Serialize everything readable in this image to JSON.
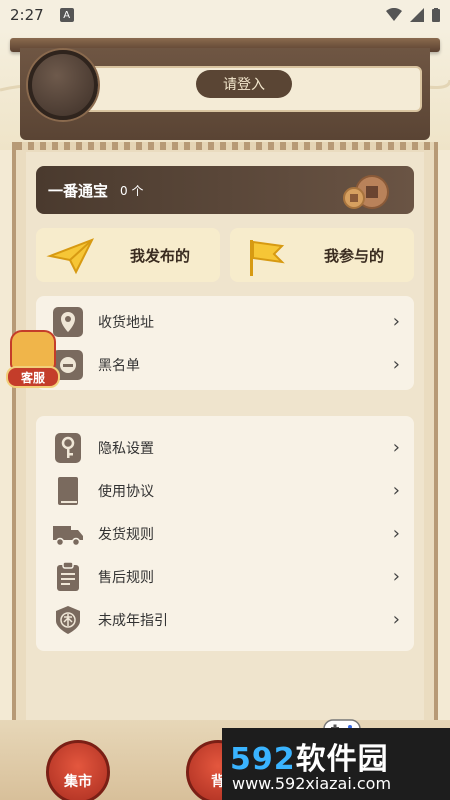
{
  "status_bar": {
    "time": "2:27",
    "badge": "A"
  },
  "header": {
    "login_label": "请登入"
  },
  "token": {
    "title": "一番通宝",
    "count": "0 个"
  },
  "actions": [
    {
      "label": "我发布的"
    },
    {
      "label": "我参与的"
    }
  ],
  "menu_group_1": [
    {
      "label": "收货地址",
      "icon": "location-icon"
    },
    {
      "label": "黑名单",
      "icon": "block-icon"
    }
  ],
  "menu_group_2": [
    {
      "label": "隐私设置",
      "icon": "key-icon"
    },
    {
      "label": "使用协议",
      "icon": "book-icon"
    },
    {
      "label": "发货规则",
      "icon": "truck-icon"
    },
    {
      "label": "售后规则",
      "icon": "clipboard-icon"
    },
    {
      "label": "未成年指引",
      "icon": "shield-icon"
    }
  ],
  "service": {
    "label": "客服"
  },
  "bottom_nav": [
    {
      "label": "集市"
    },
    {
      "label": "背"
    }
  ],
  "watermark": {
    "brand_num": "592",
    "brand_text": "软件园",
    "url": "www.592xiazai.com"
  },
  "chevron": "›"
}
